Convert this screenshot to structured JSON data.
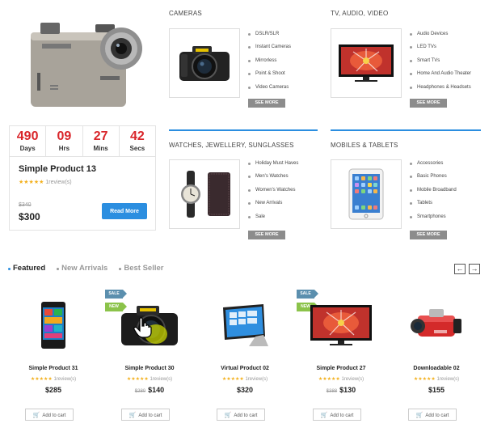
{
  "deal": {
    "countdown": [
      {
        "value": "490",
        "unit": "Days"
      },
      {
        "value": "09",
        "unit": "Hrs"
      },
      {
        "value": "27",
        "unit": "Mins"
      },
      {
        "value": "42",
        "unit": "Secs"
      }
    ],
    "name": "Simple Product 13",
    "stars": "★★★★★",
    "reviews": "1review(s)",
    "old_price": "$340",
    "price": "$300",
    "button": "Read More",
    "image_icon": "dashcam-image"
  },
  "categories": [
    {
      "title": "CAMERAS",
      "image_icon": "dslr-camera-image",
      "items": [
        "DSLR/SLR",
        "Instant Cameras",
        "Mirrorless",
        "Point & Shoot",
        "Video Cameras"
      ],
      "see_more": "SEE MORE"
    },
    {
      "title": "TV, AUDIO, VIDEO",
      "image_icon": "tv-image",
      "items": [
        "Audio Devices",
        "LED TVs",
        "Smart TVs",
        "Home And Audio Theater",
        "Headphones & Headsets"
      ],
      "see_more": "SEE MORE"
    },
    {
      "title": "WATCHES, JEWELLERY, SUNGLASSES",
      "image_icon": "watch-wallet-image",
      "items": [
        "Holiday Must Haves",
        "Men's Watches",
        "Women's Watches",
        "New Arrivals",
        "Sale"
      ],
      "see_more": "SEE MORE"
    },
    {
      "title": "MOBILES & TABLETS",
      "image_icon": "tablet-image",
      "items": [
        "Accessories",
        "Basic Phones",
        "Mobile Broadband",
        "Tablets",
        "Smartphones"
      ],
      "see_more": "SEE MORE"
    }
  ],
  "tabs": [
    "Featured",
    "New Arrivals",
    "Best Seller"
  ],
  "nav": {
    "prev": "←",
    "next": "→"
  },
  "products": [
    {
      "name": "Simple Product 31",
      "stars": "★★★★★",
      "reviews": "1review(s)",
      "old_price": "",
      "price": "$285",
      "sale": "",
      "new": "",
      "image_icon": "smartphone-image",
      "cart": "Add to cart"
    },
    {
      "name": "Simple Product 30",
      "stars": "★★★★★",
      "reviews": "1review(s)",
      "old_price": "$280",
      "price": "$140",
      "sale": "SALE",
      "new": "NEW",
      "image_icon": "dslr-camera-image",
      "cart": "Add to cart"
    },
    {
      "name": "Virtual Product 02",
      "stars": "★★★★★",
      "reviews": "1review(s)",
      "old_price": "",
      "price": "$320",
      "sale": "",
      "new": "",
      "image_icon": "tablet-stand-image",
      "cart": "Add to cart"
    },
    {
      "name": "Simple Product 27",
      "stars": "★★★★★",
      "reviews": "1review(s)",
      "old_price": "$388",
      "price": "$130",
      "sale": "SALE",
      "new": "NEW",
      "image_icon": "tv-image",
      "cart": "Add to cart"
    },
    {
      "name": "Downloadable 02",
      "stars": "★★★★★",
      "reviews": "1review(s)",
      "old_price": "",
      "price": "$155",
      "sale": "",
      "new": "",
      "image_icon": "camcorder-image",
      "cart": "Add to cart"
    }
  ]
}
